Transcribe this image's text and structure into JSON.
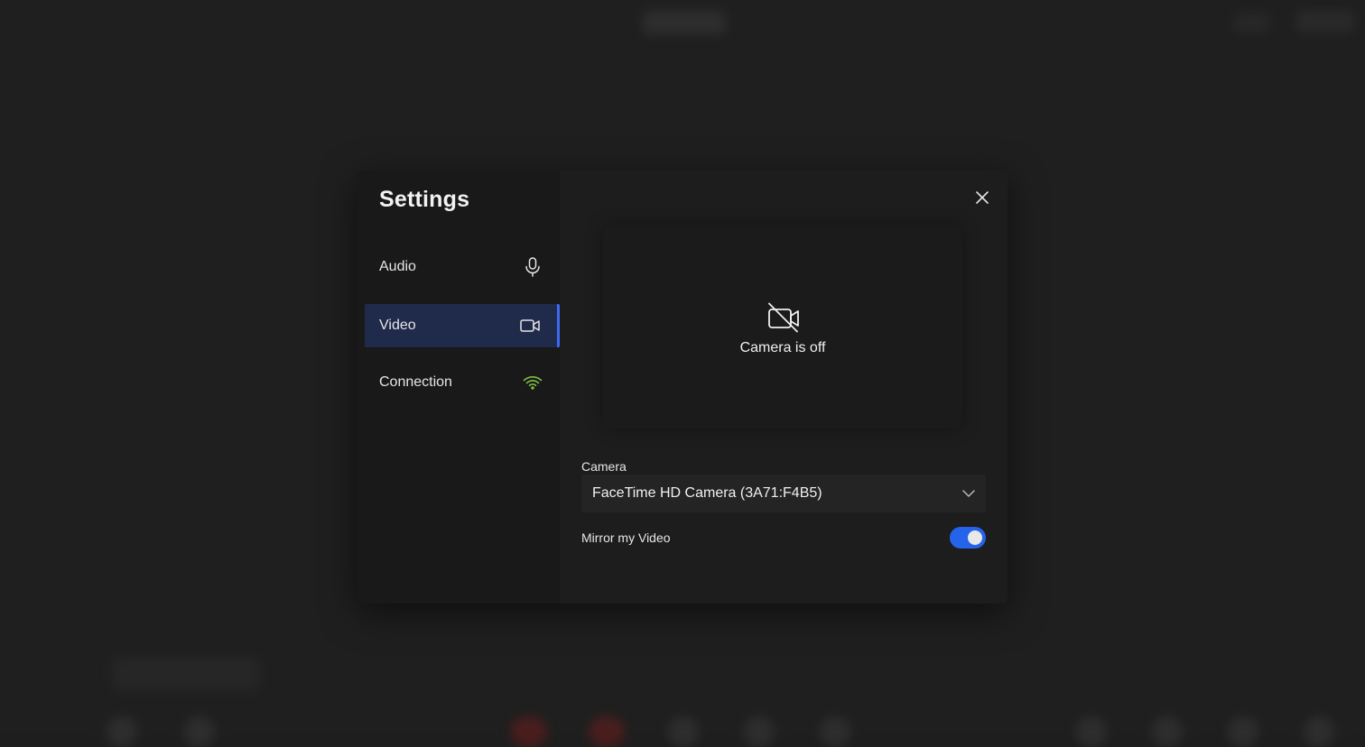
{
  "settings": {
    "title": "Settings",
    "nav": [
      {
        "label": "Audio",
        "icon": "microphone-icon",
        "active": false
      },
      {
        "label": "Video",
        "icon": "video-camera-icon",
        "active": true
      },
      {
        "label": "Connection",
        "icon": "wifi-icon",
        "active": false
      }
    ]
  },
  "video": {
    "preview_status": "Camera is off",
    "camera_label": "Camera",
    "camera_selected": "FaceTime HD Camera (3A71:F4B5)",
    "mirror_label": "Mirror my Video",
    "mirror_enabled": true
  },
  "colors": {
    "accent": "#3b6af5",
    "toggle_on": "#2563eb",
    "active_nav_bg": "#202a4a",
    "connection_good": "#7bc043"
  }
}
